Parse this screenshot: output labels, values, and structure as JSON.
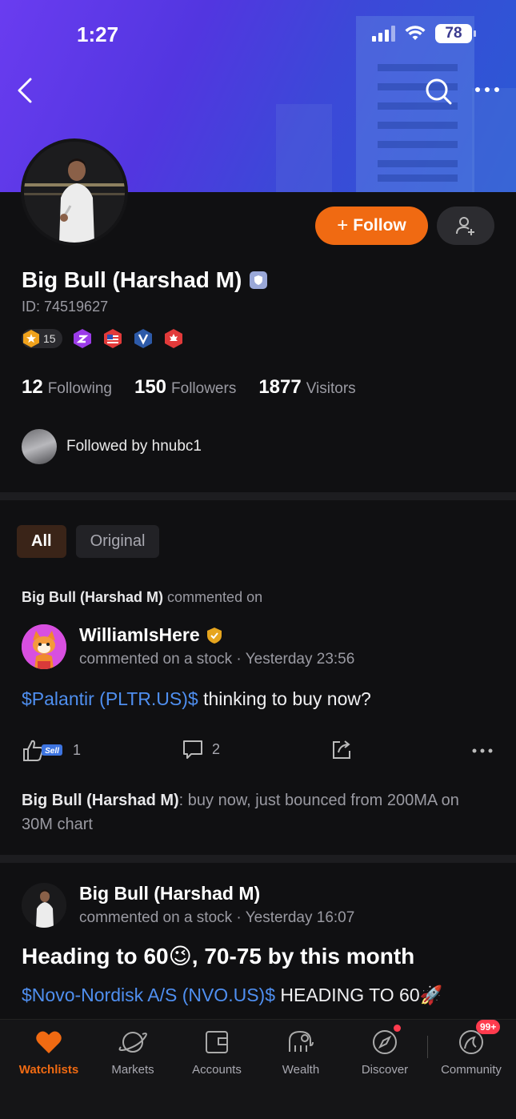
{
  "status_bar": {
    "time": "1:27",
    "battery": "78"
  },
  "profile": {
    "name": "Big Bull (Harshad M)",
    "id": "ID: 74519627",
    "level": "15",
    "follow_label": "Follow",
    "stats": [
      {
        "value": "12",
        "label": "Following"
      },
      {
        "value": "150",
        "label": "Followers"
      },
      {
        "value": "1877",
        "label": "Visitors"
      }
    ],
    "followed_by": "Followed by hnubc1"
  },
  "filters": {
    "all": "All",
    "original": "Original"
  },
  "post1": {
    "header_name": "Big Bull (Harshad M)",
    "header_action": "commented on",
    "author": "WilliamIsHere",
    "meta": "commented on a stock · Yesterday 23:56",
    "ticker": "$Palantir (PLTR.US)$",
    "text": " thinking to buy now?",
    "likes": "1",
    "comments": "2",
    "reply_author": "Big Bull (Harshad M)",
    "reply_text": ": buy now, just bounced from 200MA on 30M chart"
  },
  "post2": {
    "author": "Big Bull (Harshad M)",
    "meta": "commented on a stock · Yesterday 16:07",
    "title": "Heading to 60😉, 70-75 by this month",
    "ticker": "$Novo-Nordisk A/S (NVO.US)$",
    "text": " HEADING TO 60🚀"
  },
  "tabbar": {
    "items": [
      "Watchlists",
      "Markets",
      "Accounts",
      "Wealth",
      "Discover",
      "Community"
    ],
    "community_badge": "99+"
  },
  "colors": {
    "accent": "#f06a12",
    "ticker": "#4f8ff0",
    "background": "#101012"
  }
}
